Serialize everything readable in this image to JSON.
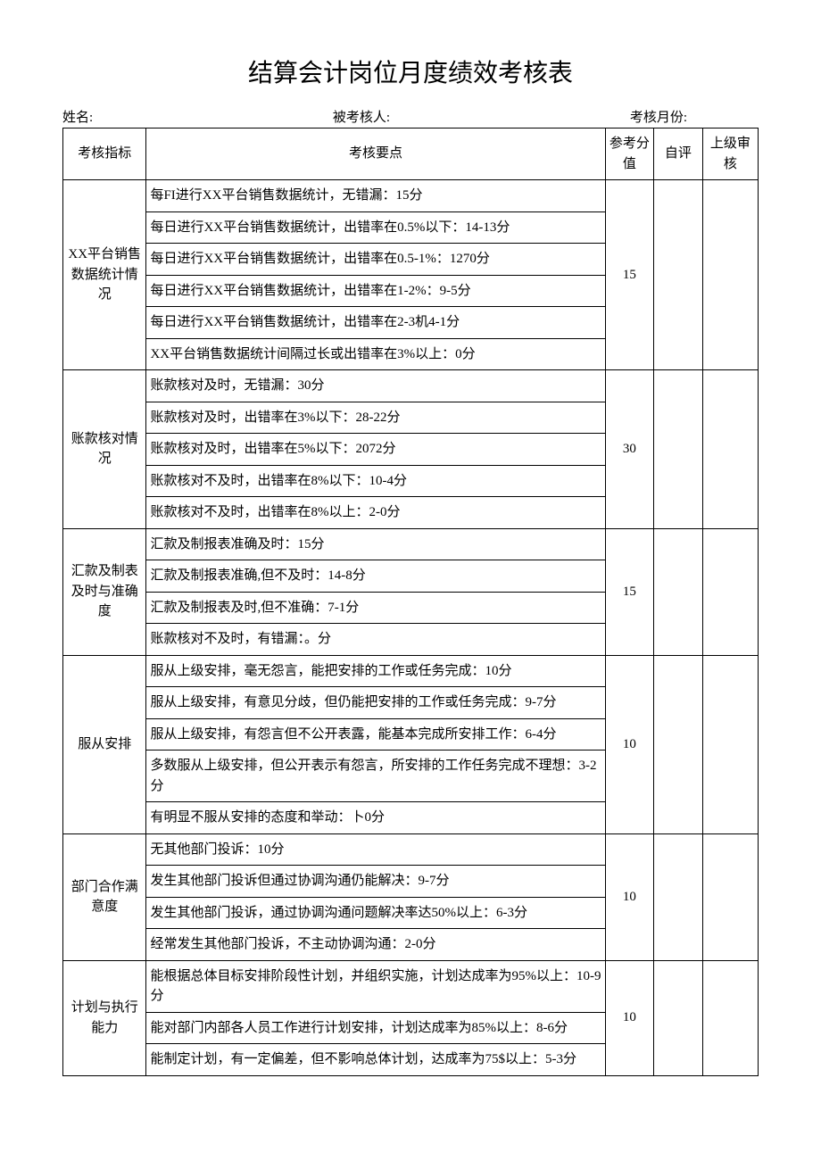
{
  "title": "结算会计岗位月度绩效考核表",
  "meta": {
    "name_label": "姓名:",
    "assessee_label": "被考核人:",
    "month_label": "考核月份:"
  },
  "headers": {
    "indicator": "考核指标",
    "points": "考核要点",
    "ref_score": "参考分值",
    "self_eval": "自评",
    "supervisor": "上级审核"
  },
  "sections": [
    {
      "indicator": "XX平台销售数据统计情况",
      "score": "15",
      "items": [
        "每FI进行XX平台销售数据统计，无错漏：15分",
        "每日进行XX平台销售数据统计，出错率在0.5%以下：14-13分",
        "每日进行XX平台销售数据统计，出错率在0.5-1%：1270分",
        "每日进行XX平台销售数据统计，出错率在1-2%：9-5分",
        "每日进行XX平台销售数据统计，出错率在2-3机4-1分",
        "XX平台销售数据统计间隔过长或出错率在3%以上：0分"
      ]
    },
    {
      "indicator": "账款核对情况",
      "score": "30",
      "items": [
        "账款核对及时，无错漏：30分",
        "账款核对及时，出错率在3%以下：28-22分",
        "账款核对及时，出错率在5%以下：2072分",
        "账款核对不及时，出错率在8%以下：10-4分",
        "账款核对不及时，出错率在8%以上：2-0分"
      ]
    },
    {
      "indicator": "汇款及制表及时与准确度",
      "score": "15",
      "items": [
        "汇款及制报表准确及时：15分",
        "汇款及制报表准确,但不及时：14-8分",
        "汇款及制报表及时,但不准确：7-1分",
        "账款核对不及时，有错漏：。分"
      ]
    },
    {
      "indicator": "服从安排",
      "score": "10",
      "items": [
        "服从上级安排，毫无怨言，能把安排的工作或任务完成：10分",
        "服从上级安排，有意见分歧，但仍能把安排的工作或任务完成：9-7分",
        "服从上级安排，有怨言但不公开表露，能基本完成所安排工作：6-4分",
        "多数服从上级安排，但公开表示有怨言，所安排的工作任务完成不理想：3-2分",
        "有明显不服从安排的态度和举动：卜0分"
      ]
    },
    {
      "indicator": "部门合作满意度",
      "score": "10",
      "items": [
        "无其他部门投诉：10分",
        "发生其他部门投诉但通过协调沟通仍能解决：9-7分",
        "发生其他部门投诉，通过协调沟通问题解决率达50%以上：6-3分",
        "经常发生其他部门投诉，不主动协调沟通：2-0分"
      ]
    },
    {
      "indicator": "计划与执行能力",
      "score": "10",
      "items": [
        "能根据总体目标安排阶段性计划，并组织实施，计划达成率为95%以上：10-9分",
        "能对部门内部各人员工作进行计划安排，计划达成率为85%以上：8-6分",
        "能制定计划，有一定偏差，但不影响总体计划，达成率为75$以上：5-3分"
      ]
    }
  ]
}
